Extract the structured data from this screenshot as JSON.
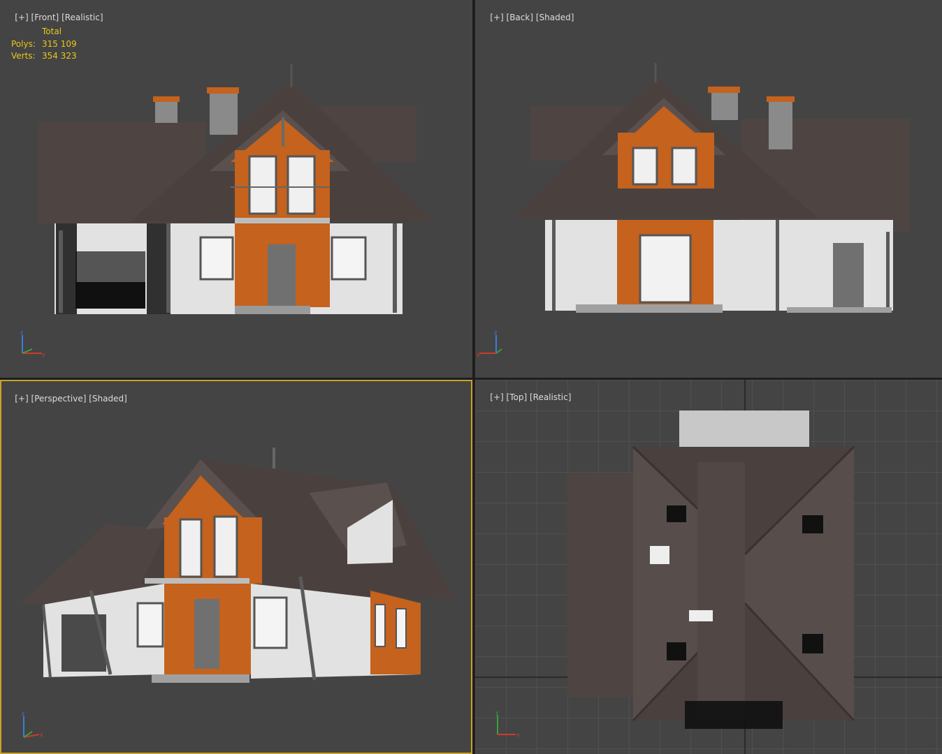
{
  "viewports": {
    "front": {
      "label_plus": "[+]",
      "label_view": "[Front]",
      "label_mode": "[Realistic]",
      "stats": {
        "header": "Total",
        "polys_label": "Polys:",
        "polys_value": "315 109",
        "verts_label": "Verts:",
        "verts_value": "354 323"
      }
    },
    "back": {
      "label_plus": "[+]",
      "label_view": "[Back]",
      "label_mode": "[Shaded]"
    },
    "perspective": {
      "label_plus": "[+]",
      "label_view": "[Perspective]",
      "label_mode": "[Shaded]",
      "active": true
    },
    "top": {
      "label_plus": "[+]",
      "label_view": "[Top]",
      "label_mode": "[Realistic]"
    }
  },
  "axis_labels": {
    "x": "x",
    "y": "y",
    "z": "z"
  },
  "colors": {
    "viewport_bg": "#444444",
    "active_border": "#c9a227",
    "roof": "#4e4543",
    "orange": "#c4621e",
    "wall": "#e2e2e2",
    "stats_text": "#e8c81c"
  }
}
